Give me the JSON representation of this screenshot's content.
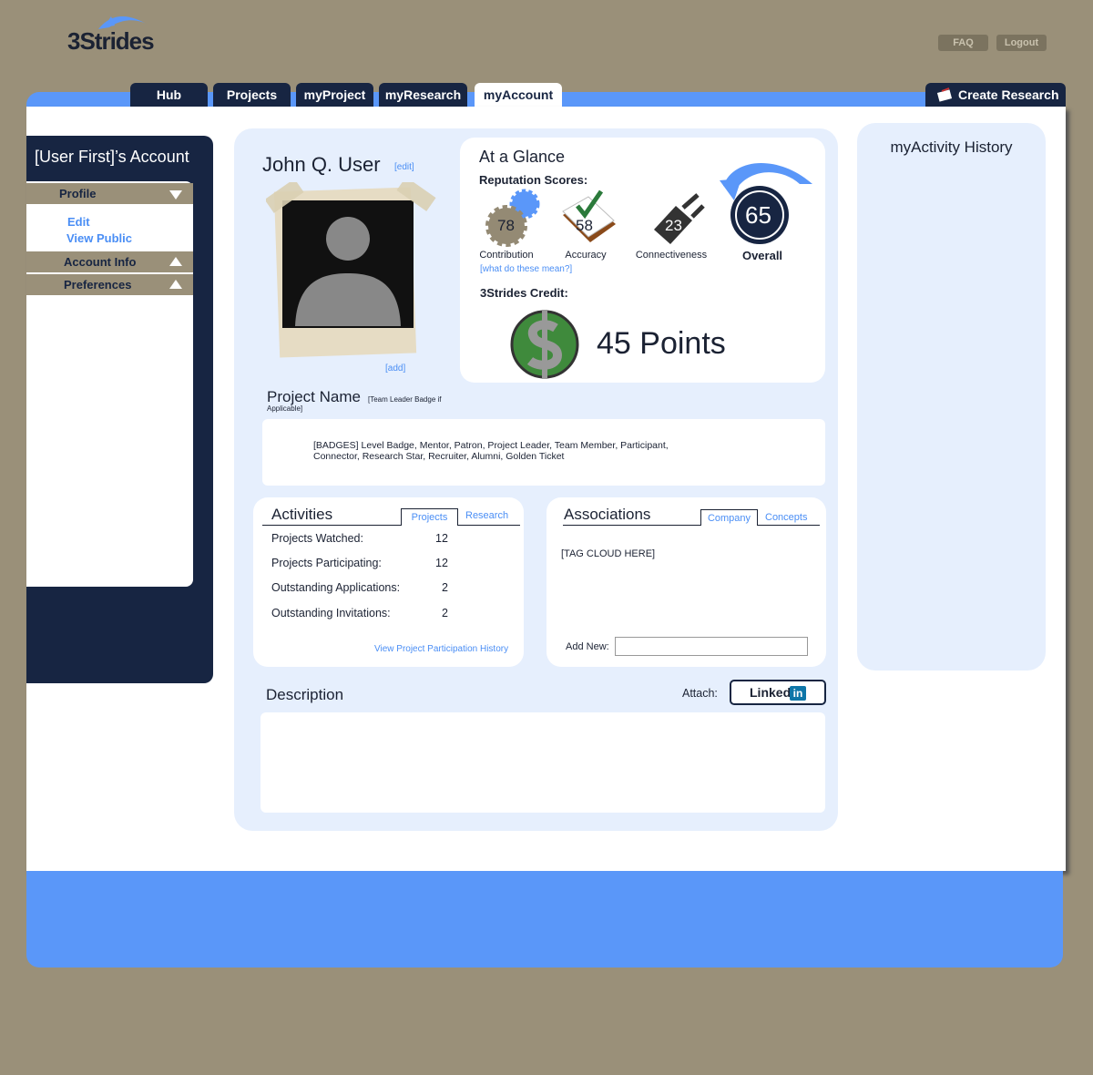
{
  "header": {
    "logo_text": "3Strides",
    "faq": "FAQ",
    "logout": "Logout"
  },
  "nav": {
    "tabs": [
      "Hub",
      "Projects",
      "myProject",
      "myResearch",
      "myAccount"
    ],
    "active": "myAccount",
    "create": "Create Research"
  },
  "sidebar": {
    "title": "[User First]’s Account",
    "profile": "Profile",
    "edit": "Edit",
    "view_public": "View Public",
    "account_info": "Account Info",
    "preferences": "Preferences"
  },
  "profile": {
    "name": "John Q. User",
    "edit": "[edit]",
    "add": "[add]"
  },
  "glance": {
    "title": "At a Glance",
    "rep_label": "Reputation Scores:",
    "contribution": {
      "value": "78",
      "label": "Contribution"
    },
    "accuracy": {
      "value": "58",
      "label": "Accuracy"
    },
    "connectiveness": {
      "value": "23",
      "label": "Connectiveness"
    },
    "overall": {
      "value": "65",
      "label": "Overall"
    },
    "what": "[what do these mean?]",
    "credit_label": "3Strides Credit:",
    "points": "45 Points"
  },
  "project": {
    "name": "Project Name",
    "badge_note": "[Team Leader Badge if Applicable]",
    "badges_line1": "[BADGES] Level Badge, Mentor, Patron, Project Leader, Team Member, Participant,",
    "badges_line2": "Connector, Research Star, Recruiter, Alumni, Golden Ticket"
  },
  "activities": {
    "title": "Activities",
    "tab1": "Projects",
    "tab2": "Research",
    "rows": [
      {
        "label": "Projects Watched:",
        "value": "12"
      },
      {
        "label": "Projects Participating:",
        "value": "12"
      },
      {
        "label": "Outstanding Applications:",
        "value": "2"
      },
      {
        "label": "Outstanding Invitations:",
        "value": "2"
      }
    ],
    "history_link": "View Project Participation History"
  },
  "associations": {
    "title": "Associations",
    "tab1": "Company",
    "tab2": "Concepts",
    "tagcloud": "[TAG CLOUD HERE]",
    "add_new": "Add New:",
    "add_value": ""
  },
  "description": {
    "title": "Description",
    "attach": "Attach:",
    "linkedin": "Linked"
  },
  "history": {
    "title": "myActivity History"
  }
}
